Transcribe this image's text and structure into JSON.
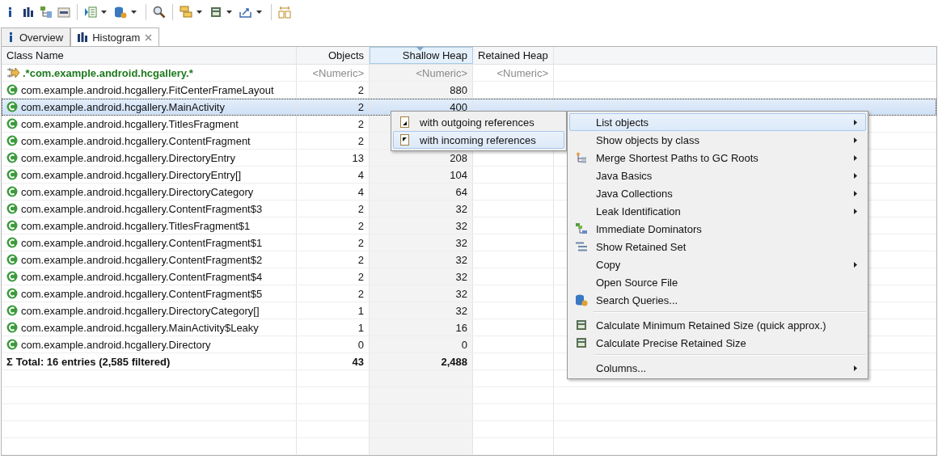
{
  "tabs": [
    {
      "label": "Overview",
      "kind": "info",
      "selected": false
    },
    {
      "label": "Histogram",
      "kind": "histogram",
      "selected": true
    }
  ],
  "table": {
    "columns": [
      {
        "label": "Class Name",
        "sorted": false
      },
      {
        "label": "Objects",
        "sorted": false
      },
      {
        "label": "Shallow Heap",
        "sorted": true
      },
      {
        "label": "Retained Heap",
        "sorted": false
      }
    ],
    "filter_row": {
      "pattern": ".*com.example.android.hcgallery.*",
      "cells": [
        "<Numeric>",
        "<Numeric>",
        "<Numeric>"
      ]
    },
    "rows": [
      {
        "name": "com.example.android.hcgallery.FitCenterFrameLayout",
        "objects": "2",
        "shallow_heap": "880",
        "selected": false
      },
      {
        "name": "com.example.android.hcgallery.MainActivity",
        "objects": "2",
        "shallow_heap": "400",
        "selected": true
      },
      {
        "name": "com.example.android.hcgallery.TitlesFragment",
        "objects": "2",
        "selected": false
      },
      {
        "name": "com.example.android.hcgallery.ContentFragment",
        "objects": "2",
        "selected": false
      },
      {
        "name": "com.example.android.hcgallery.DirectoryEntry",
        "objects": "13",
        "shallow_heap": "208",
        "selected": false
      },
      {
        "name": "com.example.android.hcgallery.DirectoryEntry[]",
        "objects": "4",
        "shallow_heap": "104",
        "selected": false
      },
      {
        "name": "com.example.android.hcgallery.DirectoryCategory",
        "objects": "4",
        "shallow_heap": "64",
        "selected": false
      },
      {
        "name": "com.example.android.hcgallery.ContentFragment$3",
        "objects": "2",
        "shallow_heap": "32",
        "selected": false
      },
      {
        "name": "com.example.android.hcgallery.TitlesFragment$1",
        "objects": "2",
        "shallow_heap": "32",
        "selected": false
      },
      {
        "name": "com.example.android.hcgallery.ContentFragment$1",
        "objects": "2",
        "shallow_heap": "32",
        "selected": false
      },
      {
        "name": "com.example.android.hcgallery.ContentFragment$2",
        "objects": "2",
        "shallow_heap": "32",
        "selected": false
      },
      {
        "name": "com.example.android.hcgallery.ContentFragment$4",
        "objects": "2",
        "shallow_heap": "32",
        "selected": false
      },
      {
        "name": "com.example.android.hcgallery.ContentFragment$5",
        "objects": "2",
        "shallow_heap": "32",
        "selected": false
      },
      {
        "name": "com.example.android.hcgallery.DirectoryCategory[]",
        "objects": "1",
        "shallow_heap": "32",
        "selected": false
      },
      {
        "name": "com.example.android.hcgallery.MainActivity$Leaky",
        "objects": "1",
        "shallow_heap": "16",
        "selected": false
      },
      {
        "name": "com.example.android.hcgallery.Directory",
        "objects": "0",
        "shallow_heap": "0",
        "selected": false
      }
    ],
    "total": {
      "symbol": "Σ",
      "label": "Total: 16 entries (2,585 filtered)",
      "objects": "43",
      "shallow_heap": "2,488"
    }
  },
  "submenu": [
    {
      "label": "with outgoing references",
      "kind": "outgoing",
      "selected": false
    },
    {
      "label": "with incoming references",
      "kind": "incoming",
      "selected": true
    }
  ],
  "context_menu": [
    {
      "kind": "plain",
      "label": "List objects",
      "submenu": true,
      "selected": true
    },
    {
      "kind": "plain",
      "label": "Show objects by class",
      "submenu": true,
      "selected": false
    },
    {
      "kind": "paths",
      "label": "Merge Shortest Paths to GC Roots",
      "submenu": true,
      "selected": false
    },
    {
      "kind": "plain",
      "label": "Java Basics",
      "submenu": true,
      "selected": false
    },
    {
      "kind": "plain",
      "label": "Java Collections",
      "submenu": true,
      "selected": false
    },
    {
      "kind": "plain",
      "label": "Leak Identification",
      "submenu": true,
      "selected": false
    },
    {
      "kind": "dominators",
      "label": "Immediate Dominators",
      "submenu": false,
      "selected": false
    },
    {
      "kind": "retained",
      "label": "Show Retained Set",
      "submenu": false,
      "selected": false
    },
    {
      "kind": "plain",
      "label": "Copy",
      "submenu": true,
      "selected": false
    },
    {
      "kind": "plain",
      "label": "Open Source File",
      "submenu": false,
      "selected": false
    },
    {
      "kind": "queries",
      "label": "Search Queries...",
      "submenu": false,
      "selected": false
    },
    {
      "kind": "separator"
    },
    {
      "kind": "calc",
      "label": "Calculate Minimum Retained Size (quick approx.)",
      "submenu": false,
      "selected": false
    },
    {
      "kind": "calc",
      "label": "Calculate Precise Retained Size",
      "submenu": false,
      "selected": false
    },
    {
      "kind": "separator"
    },
    {
      "kind": "plain",
      "label": "Columns...",
      "submenu": true,
      "selected": false
    }
  ]
}
